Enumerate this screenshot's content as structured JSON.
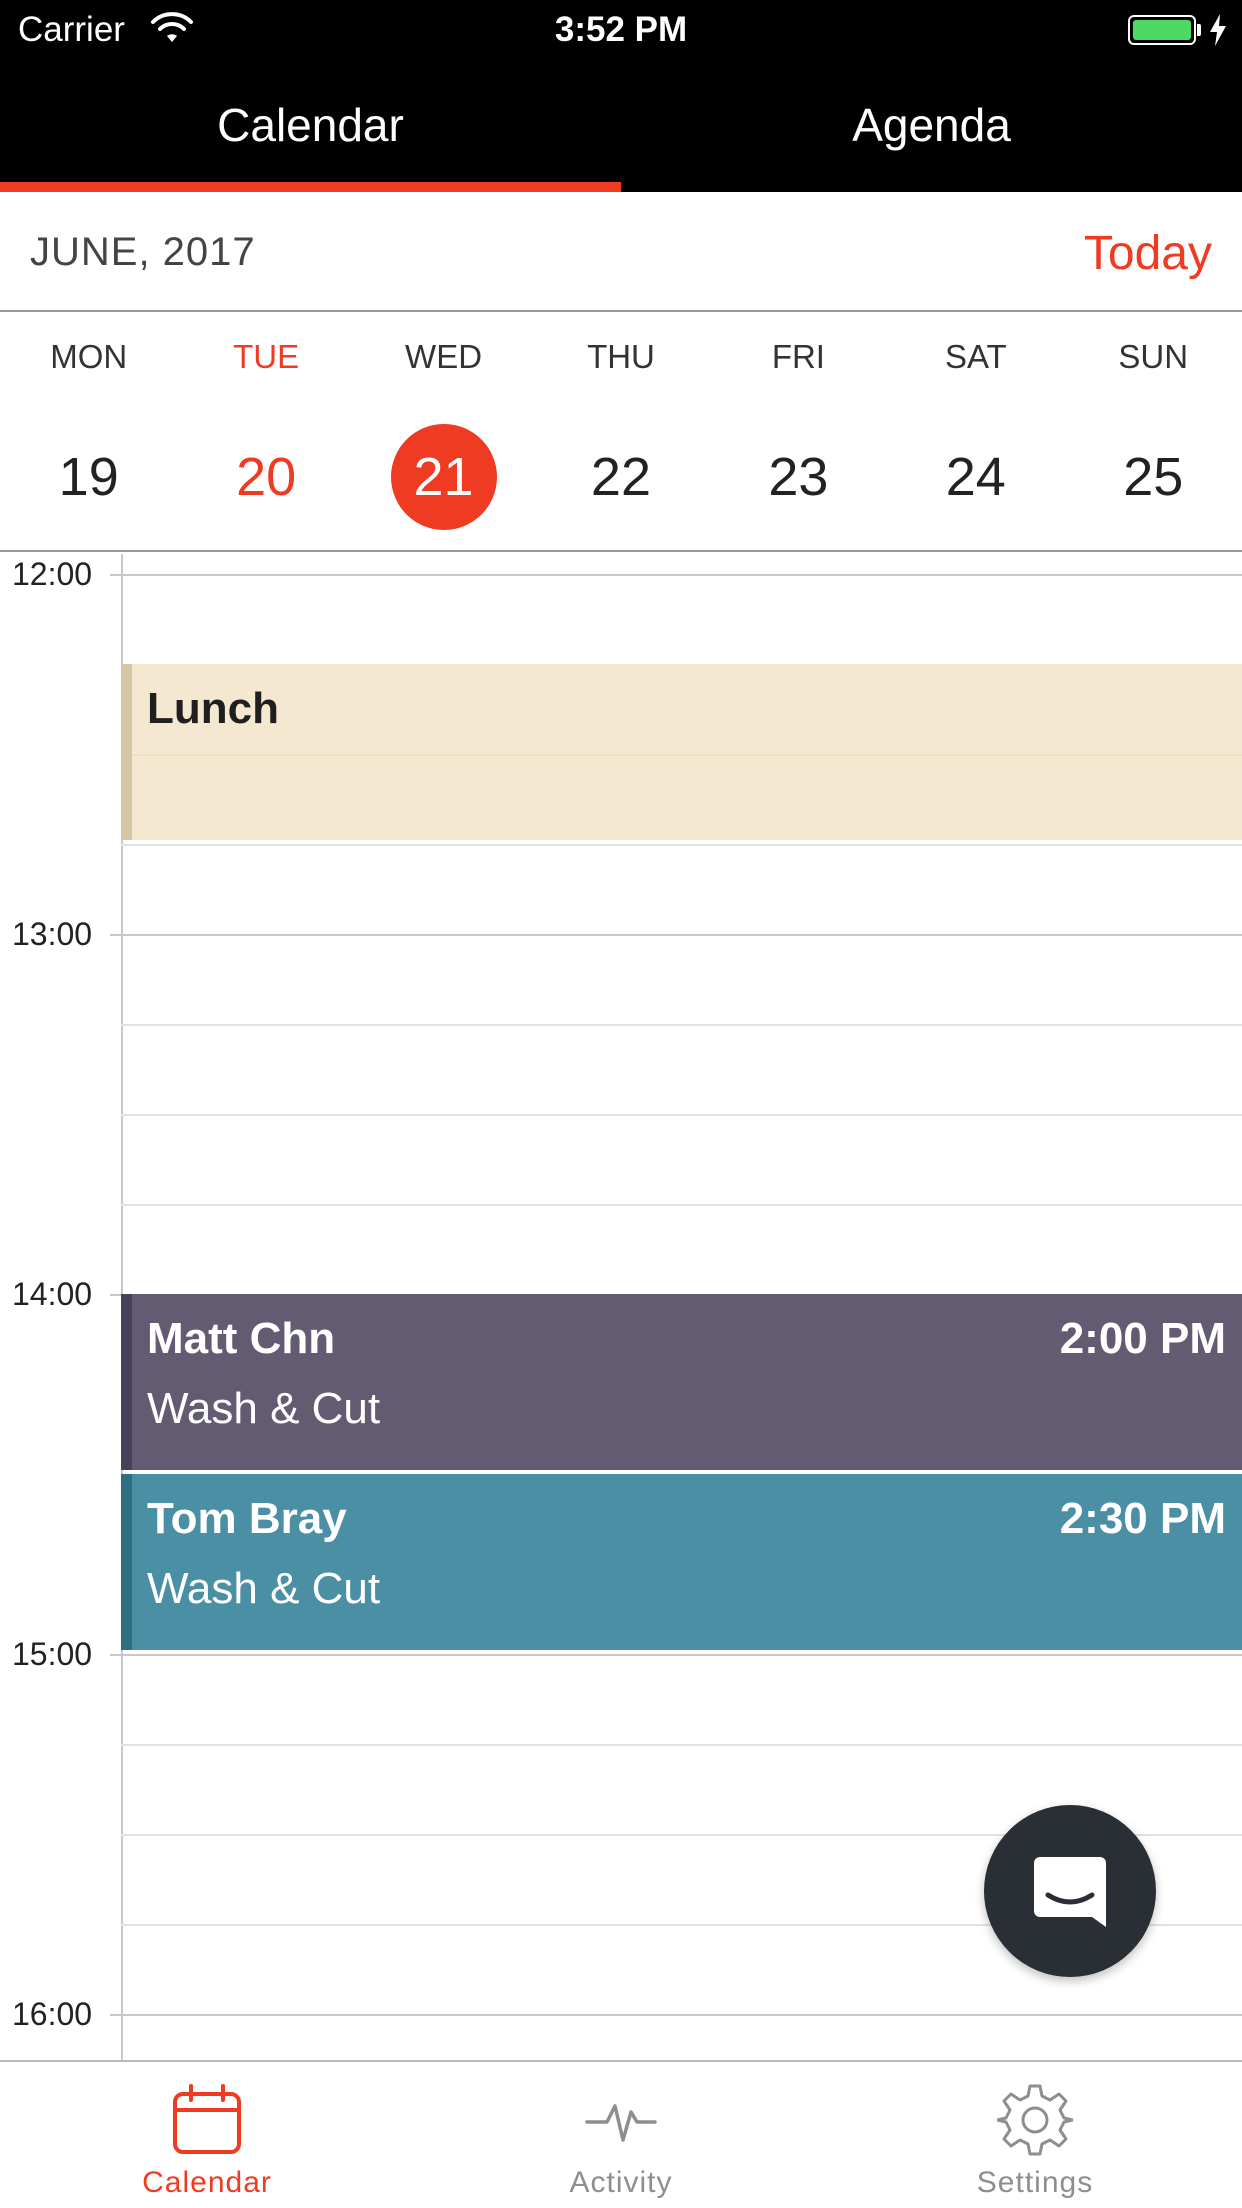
{
  "status_bar": {
    "carrier": "Carrier",
    "time": "3:52 PM",
    "wifi_icon": "wifi-icon",
    "battery_icon": "battery-charging-icon"
  },
  "top_tabs": [
    {
      "label": "Calendar",
      "active": true
    },
    {
      "label": "Agenda",
      "active": false
    }
  ],
  "header": {
    "month": "JUNE, 2017",
    "today_label": "Today"
  },
  "week": [
    {
      "name": "MON",
      "num": "19"
    },
    {
      "name": "TUE",
      "num": "20",
      "is_today": true
    },
    {
      "name": "WED",
      "num": "21",
      "selected": true
    },
    {
      "name": "THU",
      "num": "22"
    },
    {
      "name": "FRI",
      "num": "23"
    },
    {
      "name": "SAT",
      "num": "24"
    },
    {
      "name": "SUN",
      "num": "25"
    }
  ],
  "hours": [
    "12:00",
    "13:00",
    "14:00",
    "15:00",
    "16:00"
  ],
  "events": [
    {
      "title": "Lunch",
      "color": "#f5e8d0"
    },
    {
      "title": "Matt Chn",
      "time": "2:00 PM",
      "service": "Wash & Cut",
      "color": "#635b72"
    },
    {
      "title": "Tom Bray",
      "time": "2:30 PM",
      "service": "Wash & Cut",
      "color": "#4a8fa3"
    }
  ],
  "fab": {
    "icon": "chat-icon"
  },
  "bottom_tabs": [
    {
      "label": "Calendar",
      "icon": "calendar-icon",
      "active": true
    },
    {
      "label": "Activity",
      "icon": "activity-pulse-icon",
      "active": false
    },
    {
      "label": "Settings",
      "icon": "gear-icon",
      "active": false
    }
  ],
  "colors": {
    "accent": "#ef3b22",
    "topbar": "#000000"
  }
}
